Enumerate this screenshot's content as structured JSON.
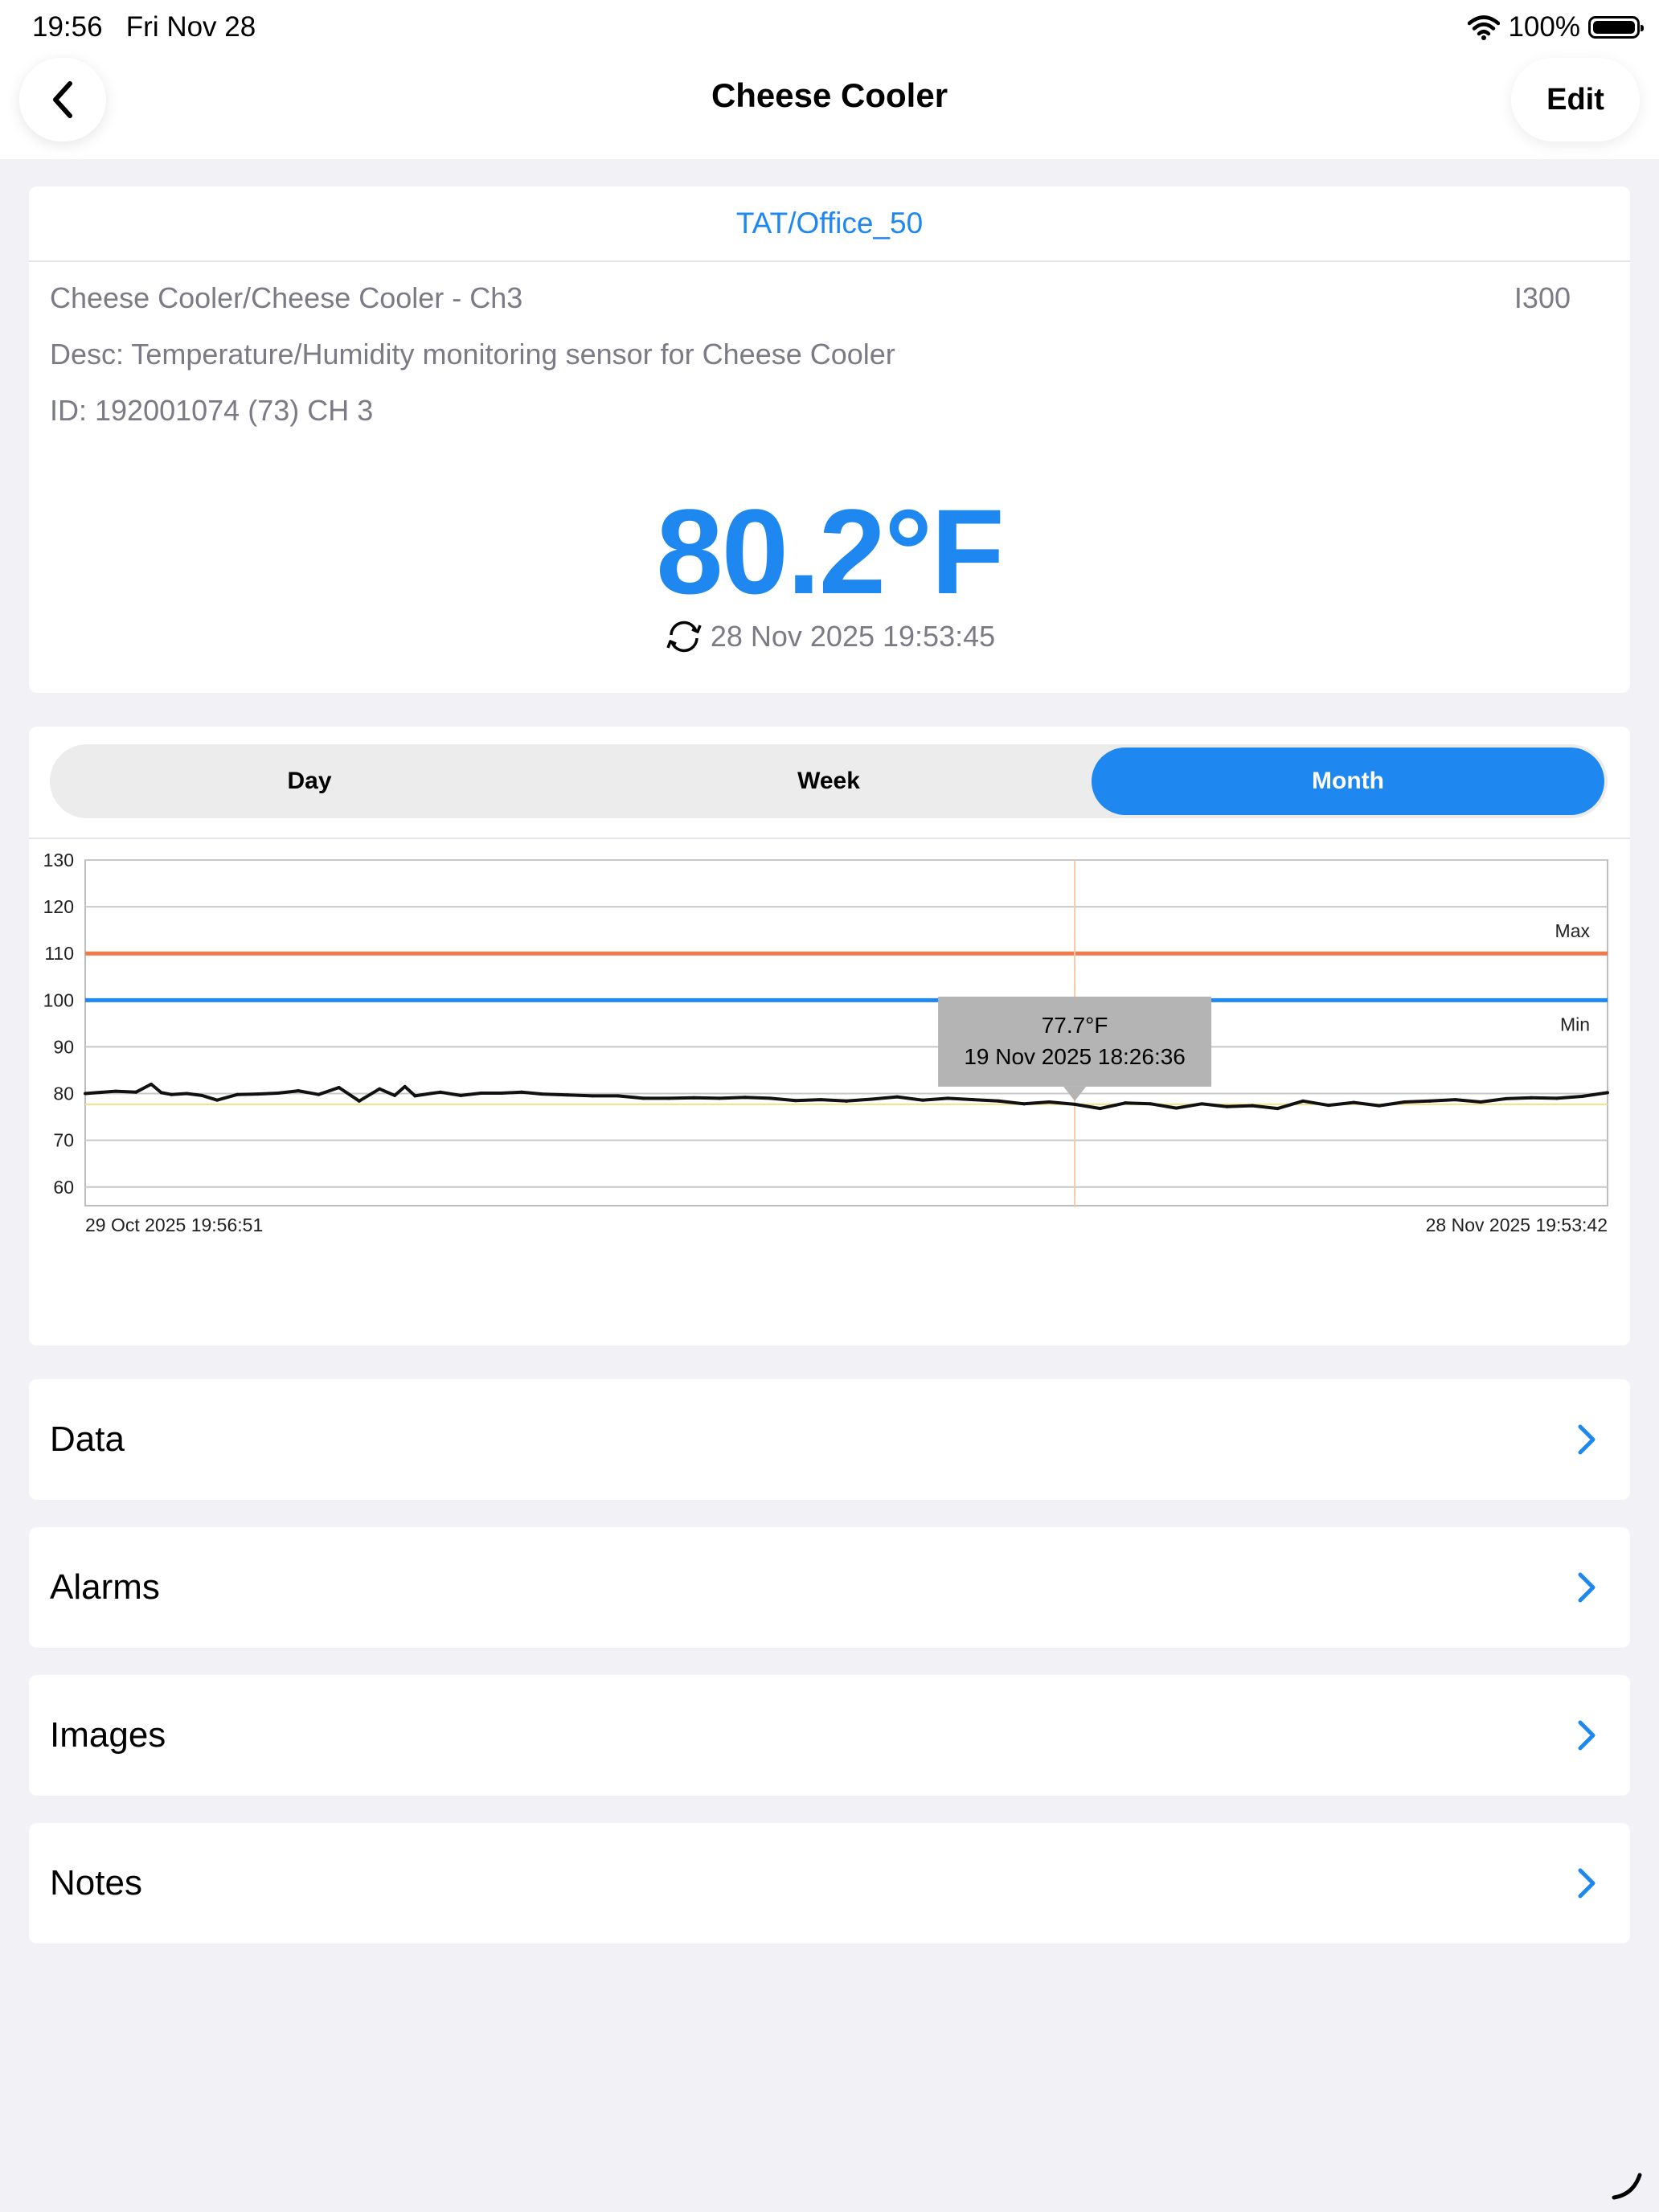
{
  "status_bar": {
    "time": "19:56",
    "date": "Fri Nov 28",
    "battery": "100%"
  },
  "nav": {
    "title": "Cheese Cooler",
    "edit_label": "Edit"
  },
  "sensor": {
    "location": "TAT/Office_50",
    "name": "Cheese Cooler/Cheese Cooler - Ch3",
    "model": "I300",
    "desc": "Desc: Temperature/Humidity monitoring sensor for Cheese Cooler",
    "id": "ID: 192001074 (73) CH 3",
    "reading": "80.2°F",
    "updated": "28 Nov 2025 19:53:45"
  },
  "range_tabs": [
    {
      "label": "Day",
      "active": false
    },
    {
      "label": "Week",
      "active": false
    },
    {
      "label": "Month",
      "active": true
    }
  ],
  "chart_data": {
    "type": "line",
    "x_start_label": "29 Oct 2025 19:56:51",
    "x_end_label": "28 Nov 2025 19:53:42",
    "ylim": [
      56,
      130
    ],
    "yticks": [
      130,
      120,
      110,
      100,
      90,
      80,
      70,
      60
    ],
    "max_line": {
      "label": "Max",
      "value": 110,
      "color": "#f07a4a"
    },
    "min_line": {
      "label": "Min",
      "value": 100,
      "color": "#1e88f0"
    },
    "series": [
      {
        "color": "#111111",
        "x": [
          0,
          0.6,
          1,
          1.3,
          1.5,
          1.7,
          2,
          2.3,
          2.6,
          3,
          3.4,
          3.8,
          4.2,
          4.6,
          5,
          5.4,
          5.8,
          6.1,
          6.3,
          6.5,
          6.8,
          7,
          7.4,
          7.8,
          8.2,
          8.6,
          9,
          9.5,
          10,
          10.5,
          11,
          11.5,
          12,
          12.5,
          13,
          13.5,
          14,
          14.5,
          15,
          15.5,
          16,
          16.5,
          17,
          17.5,
          18,
          18.5,
          19,
          19.5,
          20,
          20.5,
          21,
          21.5,
          22,
          22.5,
          23,
          23.5,
          24,
          24.5,
          25,
          25.5,
          26,
          26.5,
          27,
          27.5,
          28,
          28.5,
          29,
          29.5,
          30
        ],
        "values": [
          80.0,
          80.5,
          80.3,
          82.0,
          80.2,
          79.8,
          80.0,
          79.6,
          78.6,
          79.8,
          79.9,
          80.1,
          80.6,
          79.8,
          81.3,
          78.4,
          81.0,
          79.6,
          81.5,
          79.5,
          80.0,
          80.3,
          79.6,
          80.1,
          80.1,
          80.3,
          79.9,
          79.7,
          79.5,
          79.5,
          79.0,
          79.0,
          79.1,
          79.0,
          79.2,
          79.0,
          78.5,
          78.7,
          78.4,
          78.8,
          79.3,
          78.6,
          79.0,
          78.7,
          78.4,
          77.8,
          78.2,
          77.7,
          76.8,
          78.0,
          77.8,
          76.9,
          77.8,
          77.2,
          77.4,
          76.8,
          78.4,
          77.5,
          78.1,
          77.4,
          78.2,
          78.4,
          78.7,
          78.2,
          78.9,
          79.1,
          79.0,
          79.4,
          80.2
        ]
      }
    ],
    "tooltip": {
      "value": "77.7°F",
      "time": "19 Nov 2025 18:26:36",
      "x": 19.5,
      "y": 77.7
    }
  },
  "menu_rows": [
    {
      "label": "Data"
    },
    {
      "label": "Alarms"
    },
    {
      "label": "Images"
    },
    {
      "label": "Notes"
    }
  ]
}
